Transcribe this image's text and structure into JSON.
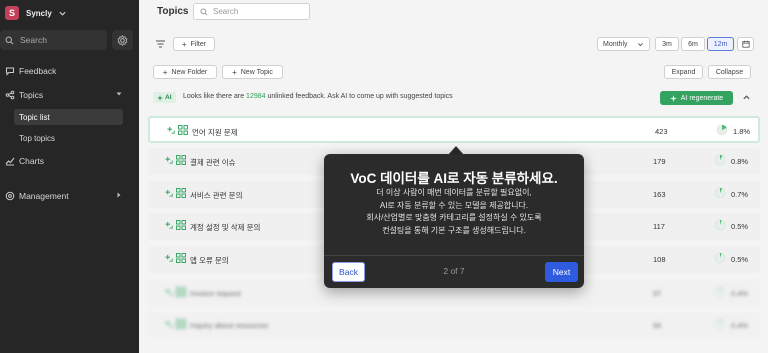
{
  "workspace": {
    "initial": "S",
    "name": "Syncly"
  },
  "sidebar": {
    "search_placeholder": "Search",
    "nav": [
      {
        "label": "Feedback"
      },
      {
        "label": "Topics"
      },
      {
        "label": "Charts"
      },
      {
        "label": "Management"
      }
    ],
    "topics_sub": [
      {
        "label": "Topic list",
        "active": true
      },
      {
        "label": "Top topics",
        "active": false
      }
    ]
  },
  "header": {
    "title": "Topics",
    "search_placeholder": "Search",
    "period_select": "Monthly",
    "ranges": [
      "3m",
      "6m",
      "12m"
    ],
    "active_range": "12m"
  },
  "toolbar": {
    "filter_label": "Filter",
    "new_folder_label": "New Folder",
    "new_topic_label": "New Topic",
    "expand_label": "Expand",
    "collapse_label": "Collapse"
  },
  "ai_banner": {
    "tag": "AI",
    "text_before": "Looks like there are ",
    "count": "12984",
    "text_after": " unlinked feedback. Ask AI to come up with suggested topics",
    "button_label": "AI regenerate"
  },
  "topics": [
    {
      "name": "언어 지원 문제",
      "count": "423",
      "percent": "1.8%",
      "share": 0.018
    },
    {
      "name": "결제 관련 이슈",
      "count": "179",
      "percent": "0.8%",
      "share": 0.008
    },
    {
      "name": "서비스 관련 문의",
      "count": "163",
      "percent": "0.7%",
      "share": 0.007
    },
    {
      "name": "계정 설정 및 삭제 문의",
      "count": "117",
      "percent": "0.5%",
      "share": 0.005
    },
    {
      "name": "앱 오류 문의",
      "count": "108",
      "percent": "0.5%",
      "share": 0.005
    },
    {
      "name": "Invoice request",
      "count": "97",
      "percent": "0.4%",
      "share": 0.004
    },
    {
      "name": "Inquiry about resources",
      "count": "94",
      "percent": "0.4%",
      "share": 0.004
    }
  ],
  "tour": {
    "title": "VoC 데이터를 AI로 자동 분류하세요.",
    "body": [
      "더 이상 사람이 매번 데이터를 분류할 필요없이,",
      "AI로 자동 분류할 수 있는 모델을 제공합니다.",
      "회사/산업별로 맞춤형 카테고리를 설정하실 수 있도록",
      "컨설팅을 통해 기본 구조를 생성해드립니다."
    ],
    "back_label": "Back",
    "step_label": "2 of 7",
    "next_label": "Next"
  },
  "colors": {
    "accent_green": "#33a35f",
    "accent_blue": "#2f5be0",
    "brand": "#c2415a"
  },
  "icons": [
    "chevron-down-icon",
    "search-icon",
    "gear-icon",
    "feedback-icon",
    "topics-icon",
    "charts-icon",
    "management-icon",
    "filter-icon",
    "plus-icon",
    "calendar-icon",
    "sparkle-icon",
    "chevron-up-icon",
    "grid-icon",
    "pie-icon"
  ]
}
